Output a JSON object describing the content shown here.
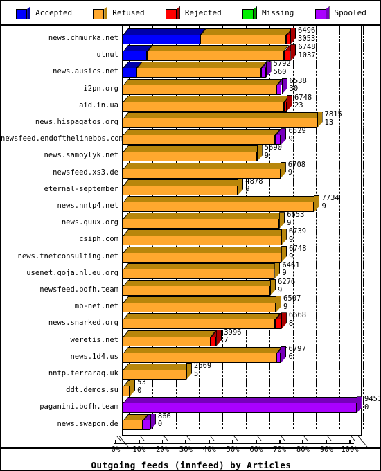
{
  "legend": {
    "items": [
      {
        "label": "Accepted",
        "icon": "cube-icon",
        "color": "#0000FF",
        "side_color": "#0000AA"
      },
      {
        "label": "Refused",
        "icon": "cube-icon",
        "color": "#FFA82E",
        "side_color": "#B8860B"
      },
      {
        "label": "Rejected",
        "icon": "cube-icon",
        "color": "#FF0000",
        "side_color": "#AA0000"
      },
      {
        "label": "Missing",
        "icon": "cube-icon",
        "color": "#00EE00",
        "side_color": "#00A000"
      },
      {
        "label": "Spooled",
        "icon": "cube-icon",
        "color": "#AA00FF",
        "side_color": "#7700BB"
      }
    ]
  },
  "chart_data": {
    "type": "bar",
    "orientation": "horizontal",
    "stacked": true,
    "title": "Outgoing feeds (innfeed) by Articles",
    "xlabel": "Outgoing feeds (innfeed) by Articles",
    "ylabel": "",
    "xlim": [
      0,
      100
    ],
    "xunit": "%",
    "grid": true,
    "legend_position": "top",
    "xticks": [
      "0%",
      "10%",
      "20%",
      "30%",
      "40%",
      "50%",
      "60%",
      "70%",
      "80%",
      "90%",
      "100%"
    ],
    "xtick_values": [
      0,
      10,
      20,
      30,
      40,
      50,
      60,
      70,
      80,
      90,
      100
    ],
    "series": [
      {
        "name": "Accepted",
        "color": "#0000FF",
        "side_color": "#0000AA"
      },
      {
        "name": "Refused",
        "color": "#FFA82E",
        "side_color": "#B8860B"
      },
      {
        "name": "Rejected",
        "color": "#FF0000",
        "side_color": "#AA0000"
      },
      {
        "name": "Missing",
        "color": "#00EE00",
        "side_color": "#00A000"
      },
      {
        "name": "Spooled",
        "color": "#AA00FF",
        "side_color": "#7700BB"
      }
    ],
    "categories": [
      "news.chmurka.net",
      "utnut",
      "news.ausics.net",
      "i2pn.org",
      "aid.in.ua",
      "news.hispagatos.org",
      "newsfeed.endofthelinebbs.com",
      "news.samoylyk.net",
      "newsfeed.xs3.de",
      "eternal-september",
      "news.nntp4.net",
      "news.quux.org",
      "csiph.com",
      "news.tnetconsulting.net",
      "usenet.goja.nl.eu.org",
      "newsfeed.bofh.team",
      "mb-net.net",
      "news.snarked.org",
      "weretis.net",
      "news.1d4.us",
      "nntp.terraraq.uk",
      "ddt.demos.su",
      "paganini.bofh.team",
      "news.swapon.de"
    ],
    "rows": [
      {
        "label": "news.chmurka.net",
        "value_top": "6496",
        "value_bottom": "3053",
        "segments": [
          {
            "s": "Accepted",
            "pct": 33.0
          },
          {
            "s": "Refused",
            "pct": 36.9
          },
          {
            "s": "Rejected",
            "pct": 1.7
          }
        ]
      },
      {
        "label": "utnut",
        "value_top": "6748",
        "value_bottom": "1037",
        "segments": [
          {
            "s": "Accepted",
            "pct": 10.5
          },
          {
            "s": "Refused",
            "pct": 58.4
          },
          {
            "s": "Rejected",
            "pct": 2.8
          }
        ]
      },
      {
        "label": "news.ausics.net",
        "value_top": "5792",
        "value_bottom": "560",
        "segments": [
          {
            "s": "Accepted",
            "pct": 5.9
          },
          {
            "s": "Refused",
            "pct": 53.4
          },
          {
            "s": "Spooled",
            "pct": 1.8
          }
        ]
      },
      {
        "label": "i2pn.org",
        "value_top": "6538",
        "value_bottom": "30",
        "segments": [
          {
            "s": "Refused",
            "pct": 65.6
          },
          {
            "s": "Spooled",
            "pct": 2.3
          }
        ]
      },
      {
        "label": "aid.in.ua",
        "value_top": "6748",
        "value_bottom": "23",
        "segments": [
          {
            "s": "Refused",
            "pct": 68.9
          },
          {
            "s": "Rejected",
            "pct": 1.2
          }
        ]
      },
      {
        "label": "news.hispagatos.org",
        "value_top": "7815",
        "value_bottom": "13",
        "segments": [
          {
            "s": "Refused",
            "pct": 83.0
          }
        ]
      },
      {
        "label": "newsfeed.endofthelinebbs.com",
        "value_top": "6529",
        "value_bottom": "9",
        "segments": [
          {
            "s": "Refused",
            "pct": 65.2
          },
          {
            "s": "Spooled",
            "pct": 2.4
          }
        ]
      },
      {
        "label": "news.samoylyk.net",
        "value_top": "5690",
        "value_bottom": "9",
        "segments": [
          {
            "s": "Refused",
            "pct": 57.3
          }
        ]
      },
      {
        "label": "newsfeed.xs3.de",
        "value_top": "6708",
        "value_bottom": "9",
        "segments": [
          {
            "s": "Refused",
            "pct": 67.4
          }
        ]
      },
      {
        "label": "eternal-september",
        "value_top": "4878",
        "value_bottom": "9",
        "segments": [
          {
            "s": "Refused",
            "pct": 49.2
          }
        ]
      },
      {
        "label": "news.nntp4.net",
        "value_top": "7734",
        "value_bottom": "9",
        "segments": [
          {
            "s": "Refused",
            "pct": 81.8
          }
        ]
      },
      {
        "label": "news.quux.org",
        "value_top": "6653",
        "value_bottom": "9",
        "segments": [
          {
            "s": "Refused",
            "pct": 66.9
          }
        ]
      },
      {
        "label": "csiph.com",
        "value_top": "6739",
        "value_bottom": "9",
        "segments": [
          {
            "s": "Refused",
            "pct": 67.7
          }
        ]
      },
      {
        "label": "news.tnetconsulting.net",
        "value_top": "6748",
        "value_bottom": "9",
        "segments": [
          {
            "s": "Refused",
            "pct": 67.8
          }
        ]
      },
      {
        "label": "usenet.goja.nl.eu.org",
        "value_top": "6461",
        "value_bottom": "9",
        "segments": [
          {
            "s": "Refused",
            "pct": 64.9
          }
        ]
      },
      {
        "label": "newsfeed.bofh.team",
        "value_top": "6276",
        "value_bottom": "9",
        "segments": [
          {
            "s": "Refused",
            "pct": 63.0
          }
        ]
      },
      {
        "label": "mb-net.net",
        "value_top": "6507",
        "value_bottom": "9",
        "segments": [
          {
            "s": "Refused",
            "pct": 65.4
          }
        ]
      },
      {
        "label": "news.snarked.org",
        "value_top": "6668",
        "value_bottom": "8",
        "segments": [
          {
            "s": "Refused",
            "pct": 65.2
          },
          {
            "s": "Rejected",
            "pct": 2.5
          }
        ]
      },
      {
        "label": "weretis.net",
        "value_top": "3996",
        "value_bottom": "7",
        "segments": [
          {
            "s": "Refused",
            "pct": 37.5
          },
          {
            "s": "Rejected",
            "pct": 2.5
          }
        ]
      },
      {
        "label": "news.1d4.us",
        "value_top": "6797",
        "value_bottom": "6",
        "segments": [
          {
            "s": "Refused",
            "pct": 65.6
          },
          {
            "s": "Spooled",
            "pct": 2.0
          }
        ]
      },
      {
        "label": "nntp.terraraq.uk",
        "value_top": "2669",
        "value_bottom": "5",
        "segments": [
          {
            "s": "Refused",
            "pct": 27.2
          }
        ]
      },
      {
        "label": "ddt.demos.su",
        "value_top": "53",
        "value_bottom": "0",
        "segments": [
          {
            "s": "Refused",
            "pct": 3.0
          }
        ]
      },
      {
        "label": "paganini.bofh.team",
        "value_top": "9451",
        "value_bottom": "0",
        "segments": [
          {
            "s": "Spooled",
            "pct": 100.0
          }
        ]
      },
      {
        "label": "news.swapon.de",
        "value_top": "866",
        "value_bottom": "0",
        "segments": [
          {
            "s": "Refused",
            "pct": 8.6
          },
          {
            "s": "Spooled",
            "pct": 3.2
          }
        ]
      }
    ]
  }
}
